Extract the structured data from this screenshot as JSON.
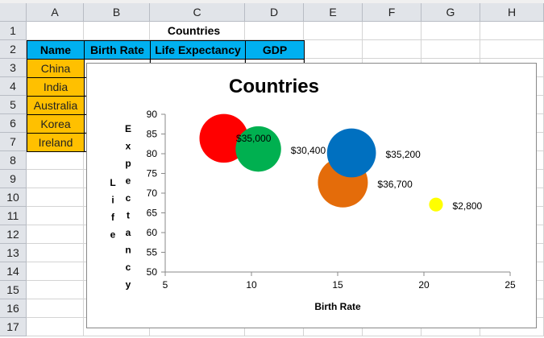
{
  "sheet": {
    "columns": [
      "A",
      "B",
      "C",
      "D",
      "E",
      "F",
      "G",
      "H"
    ],
    "rows": [
      "1",
      "2",
      "3",
      "4",
      "5",
      "6",
      "7",
      "8",
      "9",
      "10",
      "11",
      "12",
      "13",
      "14",
      "15",
      "16",
      "17"
    ],
    "title_cell": "Countries",
    "headers": [
      "Name",
      "Birth Rate",
      "Life Expectancy",
      "GDP"
    ],
    "names": [
      "China",
      "India",
      "Australia",
      "Korea",
      "Ireland"
    ],
    "header_color": "#00b0f0",
    "name_color": "#ffc000"
  },
  "chart_data": {
    "type": "bubble",
    "title": "Countries",
    "xlabel": "Birth Rate",
    "ylabel_parts": [
      "Life",
      "Expectancy"
    ],
    "xlim": [
      5,
      25
    ],
    "ylim": [
      50,
      90
    ],
    "xticks": [
      "5",
      "10",
      "15",
      "20",
      "25"
    ],
    "yticks": [
      "50",
      "55",
      "60",
      "65",
      "70",
      "75",
      "80",
      "85",
      "90"
    ],
    "grid": false,
    "points": [
      {
        "x": 8.4,
        "y": 83.9,
        "size": 35000,
        "label": "$35,000",
        "color": "#ff0000"
      },
      {
        "x": 10.4,
        "y": 81.2,
        "size": 30400,
        "label": "$30,400",
        "color": "#00b050"
      },
      {
        "x": 15.3,
        "y": 72.7,
        "size": 36700,
        "label": "$36,700",
        "color": "#e46c0a"
      },
      {
        "x": 15.8,
        "y": 80.2,
        "size": 35200,
        "label": "$35,200",
        "color": "#0070c0"
      },
      {
        "x": 20.7,
        "y": 67.1,
        "size": 2800,
        "label": "$2,800",
        "color": "#ffff00"
      }
    ]
  }
}
